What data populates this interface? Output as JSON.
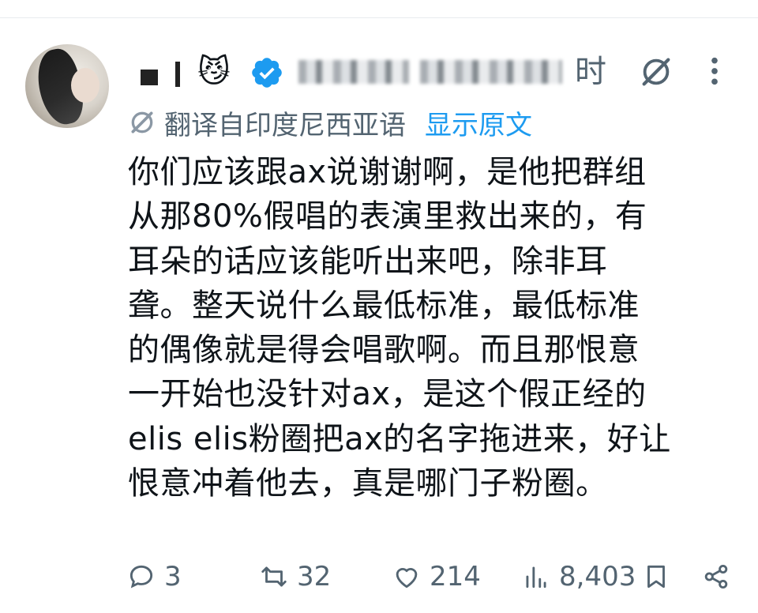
{
  "post": {
    "author": {
      "emoji": "😼",
      "time_suffix": "时"
    },
    "translation": {
      "note": "翻译自印度尼西亚语",
      "show_original": "显示原文"
    },
    "body_lines": [
      "你们应该跟ax说谢谢啊，是他把群组",
      "从那80%假唱的表演里救出来的，有",
      "耳朵的话应该能听出来吧，除非耳",
      "聋。整天说什么最低标准，最低标准",
      "的偶像就是得会唱歌啊。而且那恨意",
      "一开始也没针对ax，是这个假正经的",
      "elis elis粉圈把ax的名字拖进来，好让",
      "恨意冲着他去，真是哪门子粉圈。"
    ],
    "actions": {
      "replies": "3",
      "retweets": "32",
      "likes": "214",
      "views": "8,403"
    }
  },
  "icons": {
    "reply": "reply-icon",
    "retweet": "retweet-icon",
    "like": "heart-icon",
    "views": "views-icon",
    "bookmark": "bookmark-icon",
    "share": "share-icon",
    "grok": "grok-icon",
    "more": "more-icon",
    "verified": "verified-badge-icon",
    "translate": "translate-icon"
  },
  "colors": {
    "accent": "#1d9bf0",
    "secondary_text": "#536471",
    "text": "#0f1419"
  }
}
